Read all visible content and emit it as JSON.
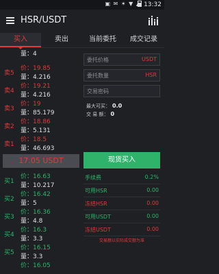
{
  "status_bar": {
    "time": "13:32",
    "icons": "▣ ✉ ✶ ▼ ▲"
  },
  "header": {
    "title": "HSR/USDT",
    "menu_icon": "hamburger-menu-icon",
    "chart_icon": "chart-bars-icon"
  },
  "tabs": [
    {
      "label": "买入",
      "active": true
    },
    {
      "label": "卖出",
      "active": false
    },
    {
      "label": "当前委托",
      "active": false
    },
    {
      "label": "成交记录",
      "active": false
    }
  ],
  "order_book": {
    "top_partial": {
      "amount": "量：4"
    },
    "sells": [
      {
        "side": "卖5",
        "price": "价：19.85",
        "amount": "量：4.216"
      },
      {
        "side": "卖4",
        "price": "价：19.21",
        "amount": "量：4.216"
      },
      {
        "side": "卖3",
        "price": "价：19",
        "amount": "量：85.179"
      },
      {
        "side": "卖2",
        "price": "价：18.86",
        "amount": "量：5.131"
      },
      {
        "side": "卖1",
        "price": "价：18.5",
        "amount": "量：46.693"
      }
    ],
    "last_price": "17.05 USDT",
    "buys": [
      {
        "side": "买1",
        "price": "价：16.63",
        "amount": "量：10.217"
      },
      {
        "side": "买2",
        "price": "价：16.42",
        "amount": "量：5"
      },
      {
        "side": "买3",
        "price": "价：16.36",
        "amount": "量：4.8"
      },
      {
        "side": "买4",
        "price": "价：16.3",
        "amount": "量：3.3"
      },
      {
        "side": "买5",
        "price": "价：16.15",
        "amount": "量：3.3"
      }
    ],
    "bottom_partial": {
      "price": "价：16.05"
    }
  },
  "form": {
    "price_field": {
      "placeholder": "委托价格",
      "unit": "USDT"
    },
    "qty_field": {
      "placeholder": "委托数量",
      "unit": "HSR"
    },
    "password_field": {
      "placeholder": "交易密码"
    },
    "max_buy": {
      "label": "最大可买：",
      "value": "0.0"
    },
    "trade_amount": {
      "label": "交 易 额：",
      "value": "0"
    },
    "submit_label": "现货买入",
    "stats": [
      {
        "label": "手续费",
        "value": "0.2%",
        "color": "green"
      },
      {
        "label": "可用HSR",
        "value": "0.00",
        "color": "green"
      },
      {
        "label": "冻结HSR",
        "value": "0.00",
        "color": "red"
      },
      {
        "label": "可用USDT",
        "value": "0.00",
        "color": "green"
      },
      {
        "label": "冻结USDT",
        "value": "0.00",
        "color": "red"
      }
    ],
    "hint": "交易额以实际成交额为准"
  },
  "colors": {
    "sell": "#e03a3a",
    "buy": "#2fb36a",
    "background": "#1e2024"
  }
}
